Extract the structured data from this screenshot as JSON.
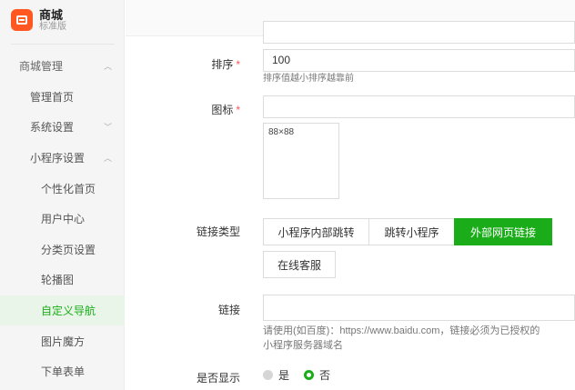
{
  "brand": {
    "name": "商城",
    "edition": "标准版"
  },
  "sidebar": {
    "items": [
      {
        "label": "商城管理",
        "chevron": "up"
      },
      {
        "label": "管理首页"
      },
      {
        "label": "系统设置",
        "chevron": "down"
      },
      {
        "label": "小程序设置",
        "chevron": "up"
      },
      {
        "label": "个性化首页"
      },
      {
        "label": "用户中心"
      },
      {
        "label": "分类页设置"
      },
      {
        "label": "轮播图"
      },
      {
        "label": "自定义导航",
        "active": true
      },
      {
        "label": "图片魔方"
      },
      {
        "label": "下单表单"
      }
    ]
  },
  "form": {
    "sort": {
      "label": "排序",
      "required_mark": "*",
      "value": "100",
      "hint": "排序值越小排序越靠前"
    },
    "icon": {
      "label": "图标",
      "required_mark": "*",
      "value": "",
      "size_hint": "88×88",
      "close": "X"
    },
    "link_type": {
      "label": "链接类型",
      "options": [
        "小程序内部跳转",
        "跳转小程序",
        "外部网页链接",
        "在线客服"
      ],
      "selected": "外部网页链接"
    },
    "link": {
      "label": "链接",
      "value": "",
      "hint_line1": "请使用(如百度)：https://www.baidu.com，链接必须为已授权的",
      "hint_line2": "小程序服务器域名"
    },
    "show": {
      "label": "是否显示",
      "yes": "是",
      "no": "否",
      "selected": "否"
    }
  },
  "colors": {
    "accent": "#1aad19",
    "brand": "#ff5722",
    "required": "#ff5252"
  }
}
